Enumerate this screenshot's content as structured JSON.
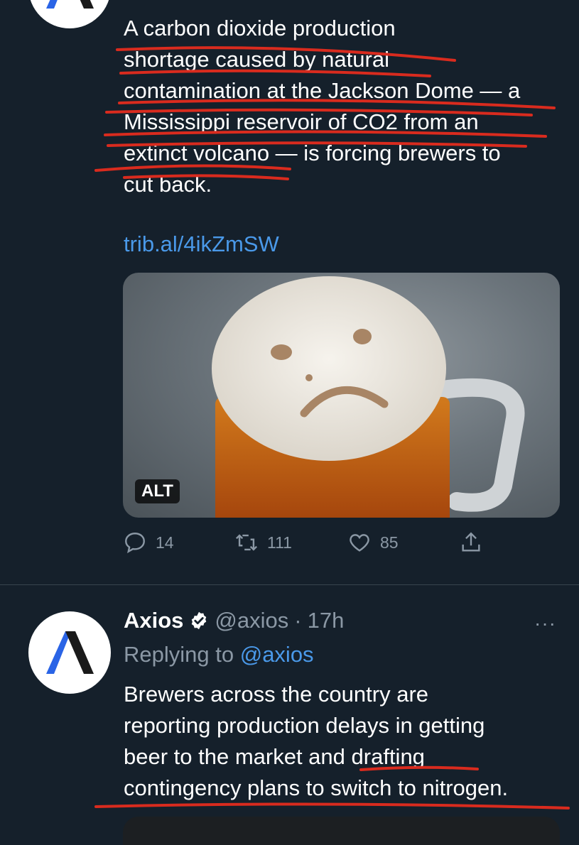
{
  "tweet1": {
    "text": "A carbon dioxide production\nshortage caused by natural\ncontamination at the Jackson Dome — a\nMississippi reservoir of CO2 from an\nextinct volcano — is forcing brewers to\ncut back.",
    "link": "trib.al/4ikZmSW",
    "media_alt_label": "ALT",
    "media_icon": "sad-face-beer-image",
    "actions": {
      "reply_count": "14",
      "retweet_count": "111",
      "like_count": "85"
    }
  },
  "tweet2": {
    "author_name": "Axios",
    "handle": "@axios",
    "separator": "·",
    "time": "17h",
    "replying_prefix": "Replying to",
    "replying_handle": "@axios",
    "more_icon": "···",
    "text": "Brewers across the country are\nreporting production delays in getting\nbeer to the market and drafting\ncontingency plans to switch to nitrogen."
  },
  "colors": {
    "background": "#15202b",
    "link": "#4a99e9",
    "muted": "#8b98a5",
    "annotation": "#d92b1e"
  }
}
